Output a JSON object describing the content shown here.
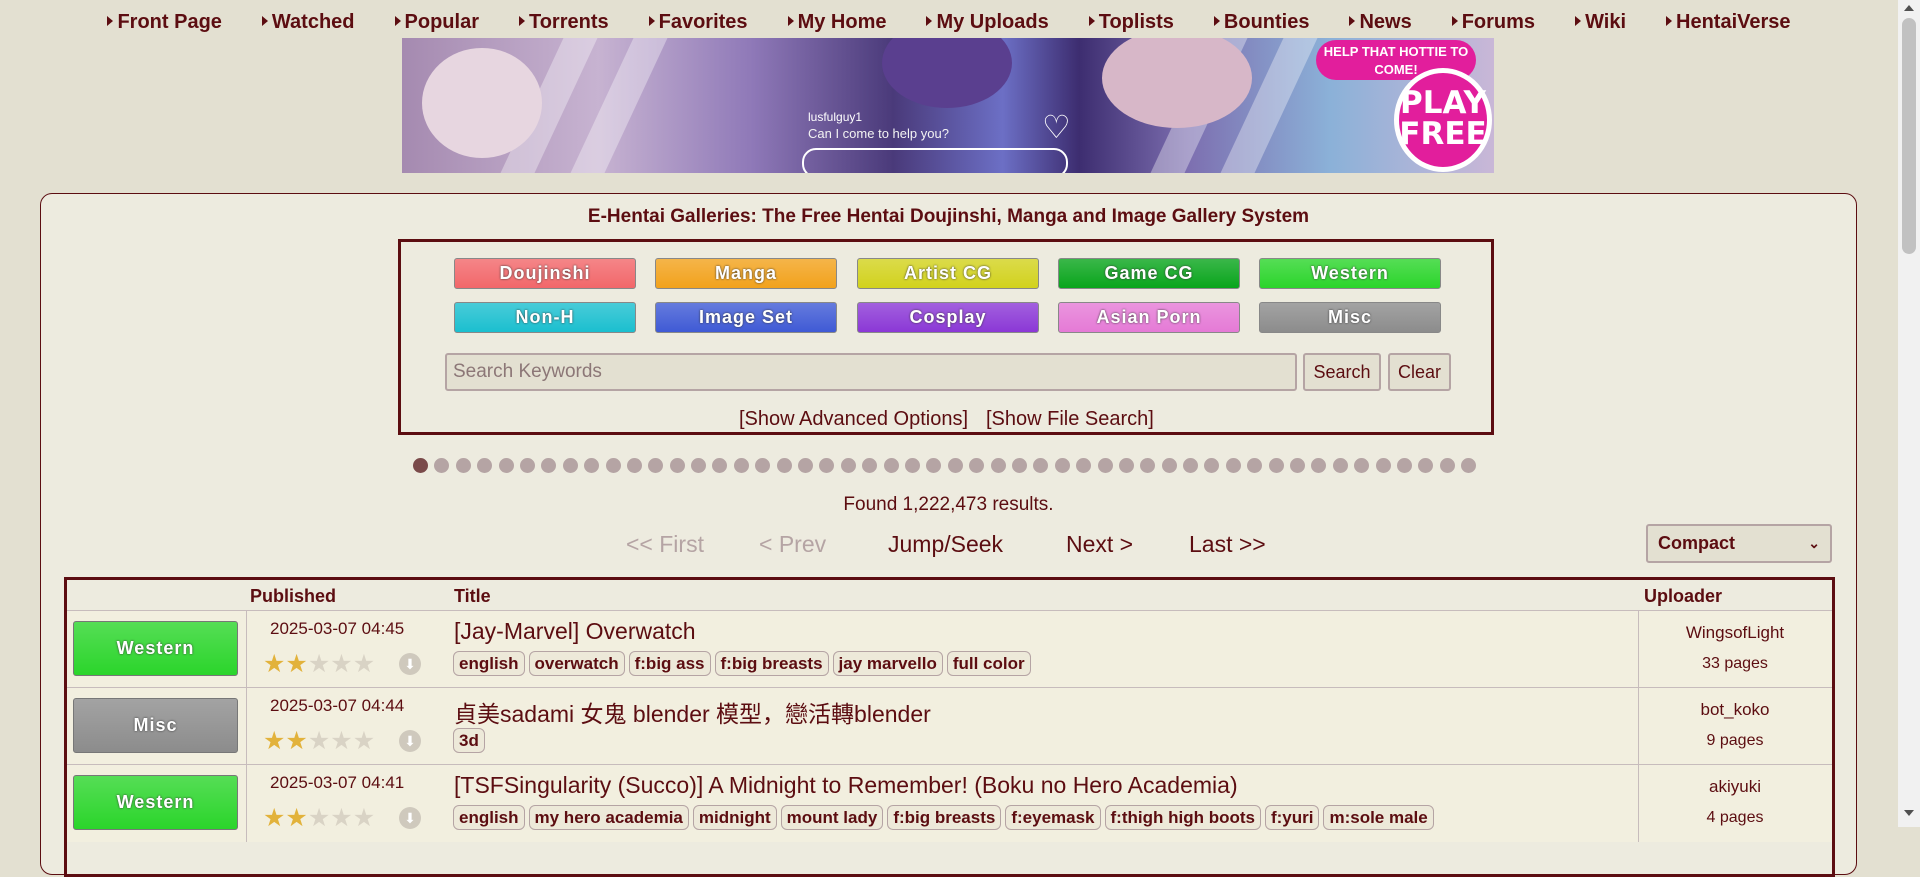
{
  "nav": {
    "items": [
      "Front Page",
      "Watched",
      "Popular",
      "Torrents",
      "Favorites",
      "My Home",
      "My Uploads",
      "Toplists",
      "Bounties",
      "News",
      "Forums",
      "Wiki",
      "HentaiVerse"
    ]
  },
  "banner": {
    "chat_user": "lusfulguy1",
    "chat_message": "Can I come to help you?",
    "badge_text": "HELP THAT HOTTIE TO COME!",
    "play_text": "PLAY FREE"
  },
  "site_title": "E-Hentai Galleries: The Free Hentai Doujinshi, Manga and Image Gallery System",
  "categories": [
    {
      "label": "Doujinshi",
      "color": "#f2676a"
    },
    {
      "label": "Manga",
      "color": "#f2a21c"
    },
    {
      "label": "Artist CG",
      "color": "#d2d21d"
    },
    {
      "label": "Game CG",
      "color": "#09a51c"
    },
    {
      "label": "Western",
      "color": "#2bd52b"
    },
    {
      "label": "Non-H",
      "color": "#1bbfcf"
    },
    {
      "label": "Image Set",
      "color": "#3f5ad5"
    },
    {
      "label": "Cosplay",
      "color": "#8b38d6"
    },
    {
      "label": "Asian Porn",
      "color": "#e57ad6"
    },
    {
      "label": "Misc",
      "color": "#8c8c8c"
    }
  ],
  "search": {
    "placeholder": "Search Keywords",
    "value": "",
    "search_label": "Search",
    "clear_label": "Clear",
    "advanced_label": "[Show Advanced Options]",
    "file_search_label": "[Show File Search]"
  },
  "found_text": "Found 1,222,473 results.",
  "pagination": {
    "first": "<< First",
    "prev": "< Prev",
    "jump": "Jump/Seek",
    "next": "Next >",
    "last": "Last >>"
  },
  "display_mode": "Compact",
  "table": {
    "headers": [
      "Published",
      "Title",
      "Uploader"
    ],
    "rows": [
      {
        "category": "Western",
        "category_color": "#2bd52b",
        "published": "2025-03-07 04:45",
        "rating": 2.0,
        "title": "[Jay-Marvel] Overwatch",
        "tags": [
          "english",
          "overwatch",
          "f:big ass",
          "f:big breasts",
          "jay marvello",
          "full color"
        ],
        "uploader": "WingsofLight",
        "pages": "33 pages"
      },
      {
        "category": "Misc",
        "category_color": "#8c8c8c",
        "published": "2025-03-07 04:44",
        "rating": 1.5,
        "title": "貞美sadami 女鬼 blender 模型，戀活轉blender",
        "tags": [
          "3d"
        ],
        "uploader": "bot_koko",
        "pages": "9 pages"
      },
      {
        "category": "Western",
        "category_color": "#2bd52b",
        "published": "2025-03-07 04:41",
        "rating": 1.5,
        "title": "[TSFSingularity (Succo)] A Midnight to Remember! (Boku no Hero Academia)",
        "tags": [
          "english",
          "my hero academia",
          "midnight",
          "mount lady",
          "f:big breasts",
          "f:eyemask",
          "f:thigh high boots",
          "f:yuri",
          "m:sole male"
        ],
        "uploader": "akiyuki",
        "pages": "4 pages"
      }
    ]
  }
}
